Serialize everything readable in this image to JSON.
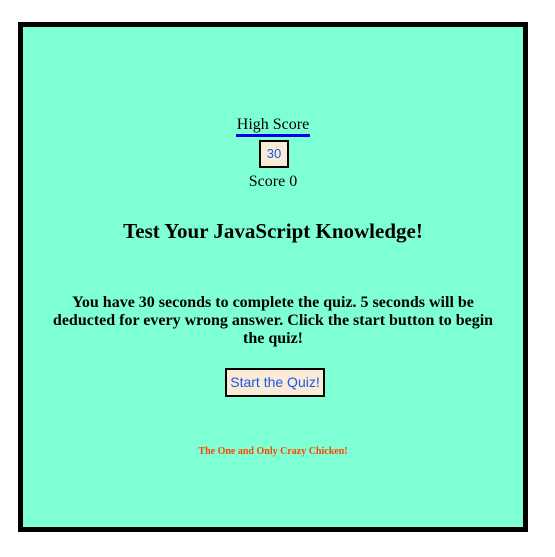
{
  "header": {
    "high_score_label": "High Score",
    "timer_value": "30",
    "score_label": "Score",
    "score_value": "0"
  },
  "main": {
    "title": "Test Your JavaScript Knowledge!",
    "instructions": "You have 30 seconds to complete the quiz. 5 seconds will be deducted for every wrong answer. Click the start button to begin the quiz!",
    "start_button_label": "Start the Quiz!"
  },
  "footer": {
    "tagline": "The One and Only Crazy Chicken!"
  },
  "colors": {
    "page_background": "#ffffff",
    "quiz_background": "#7fffd4",
    "frame_border": "#000000",
    "button_background": "#faebd7",
    "button_text": "#1a56e8",
    "link_underline": "#0000ee",
    "footer_text": "#ff4500"
  }
}
